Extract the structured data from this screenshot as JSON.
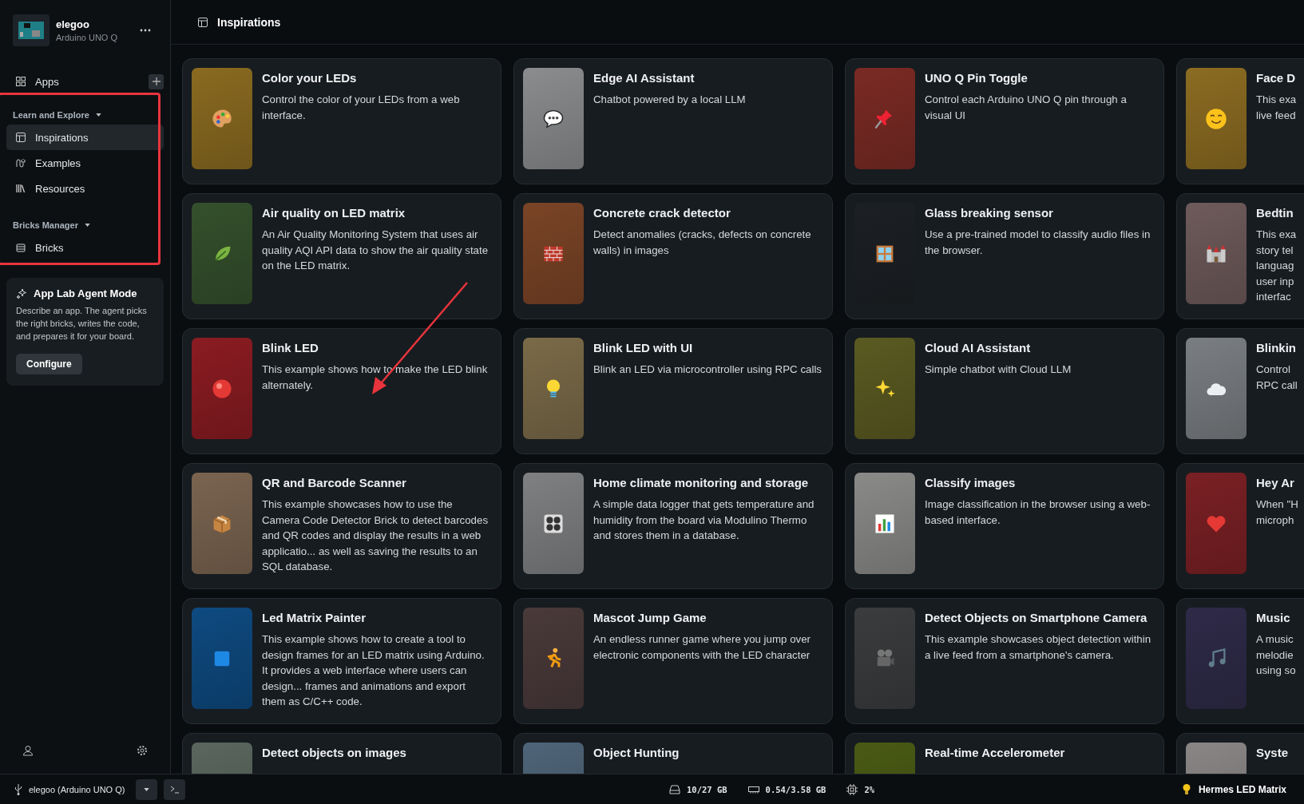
{
  "device": {
    "name": "elegoo",
    "board": "Arduino UNO Q"
  },
  "sidebar": {
    "apps": {
      "label": "Apps"
    },
    "sections": [
      {
        "title": "Learn and Explore",
        "expanded": true,
        "items": [
          {
            "label": "Inspirations",
            "selected": true
          },
          {
            "label": "Examples",
            "selected": false
          },
          {
            "label": "Resources",
            "selected": false
          }
        ]
      },
      {
        "title": "Bricks Manager",
        "expanded": true,
        "items": [
          {
            "label": "Bricks",
            "selected": false
          }
        ]
      }
    ],
    "agent": {
      "title": "App Lab Agent Mode",
      "description": "Describe an app. The agent picks the right bricks, writes the code, and prepares it for your board.",
      "button": "Configure"
    }
  },
  "header": {
    "title": "Inspirations"
  },
  "cards": [
    {
      "title": "Color your LEDs",
      "description": "Control the color of your LEDs from a web interface.",
      "color": "#8a6a20"
    },
    {
      "title": "Edge AI Assistant",
      "description": "Chatbot powered by a local LLM",
      "color": "#8a8c8e"
    },
    {
      "title": "UNO Q Pin Toggle",
      "description": "Control each Arduino UNO Q pin through a visual UI",
      "color": "#7a2a24"
    },
    {
      "title": "Face D",
      "description": "This exa\nlive feed",
      "color": "#8c6c22"
    },
    {
      "title": "Air quality on LED matrix",
      "description": "An Air Quality Monitoring System that uses air quality AQI API data to show the air quality state on the LED matrix.",
      "color": "#34502c"
    },
    {
      "title": "Concrete crack detector",
      "description": "Detect anomalies (cracks, defects on concrete walls) in images",
      "color": "#7a4426"
    },
    {
      "title": "Glass breaking sensor",
      "description": "Use a pre-trained model to classify audio files in the browser.",
      "color": "#1c2024"
    },
    {
      "title": "Bedtin",
      "description": "This exa\nstory tel\nlanguag\nuser inp\ninterfac",
      "color": "#6e5a5a"
    },
    {
      "title": "Blink LED",
      "description": "This example shows how to make the LED blink alternately.",
      "color": "#8a1c22"
    },
    {
      "title": "Blink LED with UI",
      "description": "Blink an LED via microcontroller using RPC calls",
      "color": "#7a6a48"
    },
    {
      "title": "Cloud AI Assistant",
      "description": "Simple chatbot with Cloud LLM",
      "color": "#5a5a22"
    },
    {
      "title": "Blinkin",
      "description": "Control\nRPC call",
      "color": "#7a7e82"
    },
    {
      "title": "QR and Barcode Scanner",
      "description": "This example showcases how to use the Camera Code Detector Brick to detect barcodes and QR codes and display the results in a web applicatio... as well as saving the results to an SQL database.",
      "color": "#7a6450"
    },
    {
      "title": "Home climate monitoring and storage",
      "description": "A simple data logger that gets temperature and humidity from the board via Modulino Thermo and stores them in a database.",
      "color": "#7e8082"
    },
    {
      "title": "Classify images",
      "description": "Image classification in the browser using a web-based interface.",
      "color": "#8a8a88"
    },
    {
      "title": "Hey Ar",
      "description": "When \"H\nmicroph",
      "color": "#7a2024"
    },
    {
      "title": "Led Matrix Painter",
      "description": "This example shows how to create a tool to design frames for an LED matrix using Arduino. It provides a web interface where users can design... frames and animations and export them as C/C++ code.",
      "color": "#0e4a80"
    },
    {
      "title": "Mascot Jump Game",
      "description": "An endless runner game where you jump over electronic components with the LED character",
      "color": "#4a3a3a"
    },
    {
      "title": "Detect Objects on Smartphone Camera",
      "description": "This example showcases object detection within a live feed from a smartphone's camera.",
      "color": "#3a3c3e"
    },
    {
      "title": "Music",
      "description": "A music\nmelodie\nusing so",
      "color": "#2e2a48"
    },
    {
      "title": "Detect objects on images",
      "color": "#5a665e"
    },
    {
      "title": "Object Hunting",
      "color": "#4e6478"
    },
    {
      "title": "Real-time Accelerometer",
      "color": "#4a5a14"
    },
    {
      "title": "Syste",
      "color": "#8a8686"
    }
  ],
  "status_bar": {
    "device": "elegoo (Arduino UNO Q)",
    "storage": "10/27 GB",
    "memory": "0.54/3.58 GB",
    "cpu": "2%",
    "app": "Hermes LED Matrix"
  }
}
